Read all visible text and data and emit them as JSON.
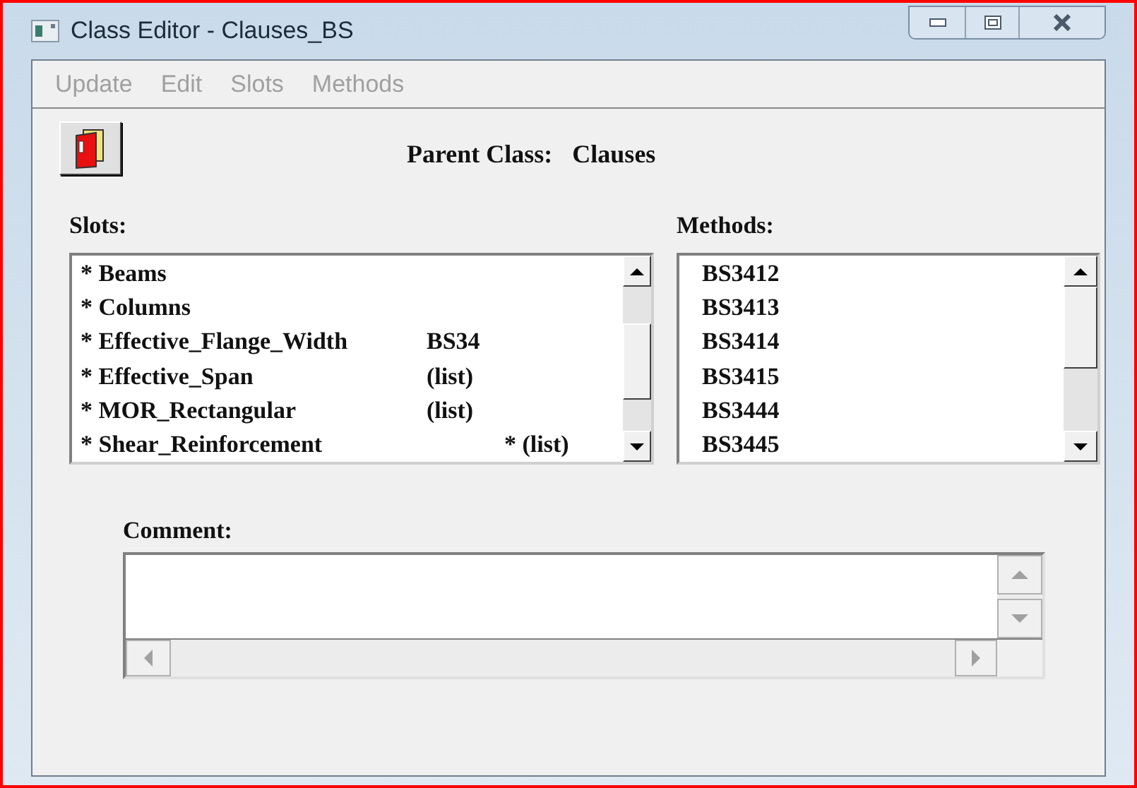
{
  "window": {
    "title": "Class Editor - Clauses_BS"
  },
  "menu": [
    {
      "label": "Update",
      "disabled": true
    },
    {
      "label": "Edit",
      "disabled": true
    },
    {
      "label": "Slots",
      "disabled": true
    },
    {
      "label": "Methods",
      "disabled": true
    }
  ],
  "parent_class": {
    "label": "Parent Class:",
    "value": "Clauses"
  },
  "slots": {
    "label": "Slots:",
    "items": [
      {
        "name": "* Beams"
      },
      {
        "name": "* Columns"
      },
      {
        "name": "* Effective_Flange_Width",
        "tag": "BS34"
      },
      {
        "name": "* Effective_Span",
        "tag": "(list)"
      },
      {
        "name": "* MOR_Rectangular",
        "tag": "(list)"
      },
      {
        "name": "* Shear_Reinforcement",
        "tag": "* (list)"
      }
    ]
  },
  "methods": {
    "label": "Methods:",
    "items": [
      "BS3412",
      "BS3413",
      "BS3414",
      "BS3415",
      "BS3444",
      "BS3445"
    ]
  },
  "comment": {
    "label": "Comment:"
  }
}
